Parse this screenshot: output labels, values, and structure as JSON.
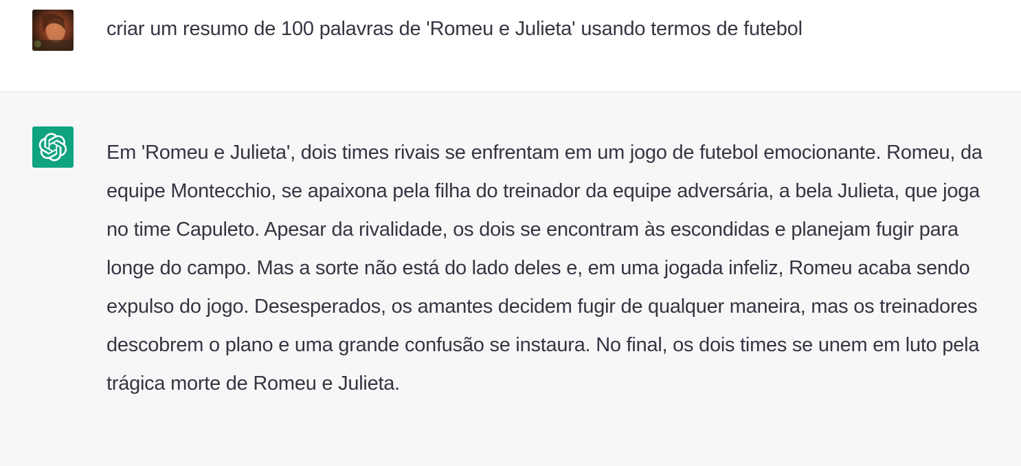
{
  "conversation": {
    "user_message": {
      "avatar_icon": "user-photo-avatar",
      "text": "criar um resumo de 100 palavras de 'Romeu e Julieta' usando termos de futebol"
    },
    "assistant_message": {
      "avatar_icon": "chatgpt-logo-icon",
      "text": "Em 'Romeu e Julieta', dois times rivais se enfrentam em um jogo de futebol emocionante. Romeu, da equipe Montecchio, se apaixona pela filha do treinador da equipe adversária, a bela Julieta, que joga no time Capuleto. Apesar da rivalidade, os dois se encontram às escondidas e planejam fugir para longe do campo. Mas a sorte não está do lado deles e, em uma jogada infeliz, Romeu acaba sendo expulso do jogo. Desesperados, os amantes decidem fugir de qualquer maneira, mas os treinadores descobrem o plano e uma grande confusão se instaura. No final, os dois times se unem em luto pela trágica morte de Romeu e Julieta."
    }
  },
  "colors": {
    "assistant_background": "#f7f7f8",
    "user_background": "#ffffff",
    "logo_green": "#10a37f",
    "text": "#343541"
  }
}
